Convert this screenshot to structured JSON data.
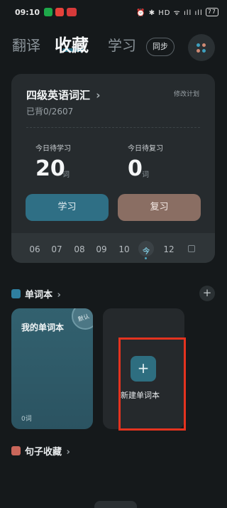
{
  "status_bar": {
    "time": "09:10",
    "system_text": "⏰ ✱ HD ᯤ ıll ıll",
    "battery": "77"
  },
  "header": {
    "tabs": [
      {
        "label": "翻译"
      },
      {
        "label": "收藏"
      },
      {
        "label": "学习"
      }
    ],
    "sync_label": "同步"
  },
  "plan_card": {
    "title": "四级英语词汇",
    "title_chevron": "›",
    "progress": "已背0/2607",
    "edit_label": "修改计划",
    "study_label": "今日待学习",
    "study_count": "20",
    "study_unit": "词",
    "review_label": "今日待复习",
    "review_count": "0",
    "review_unit": "词",
    "study_button": "学习",
    "review_button": "复习",
    "dates": [
      "06",
      "07",
      "08",
      "09",
      "10",
      "今",
      "12"
    ]
  },
  "wordbook_section": {
    "title": "单词本",
    "chevron": "›",
    "add_label": "+"
  },
  "wordbook": {
    "name": "我的单词本",
    "count": "0词",
    "badge": "默认"
  },
  "new_wordbook": {
    "icon": "+",
    "label": "新建单词本"
  },
  "sentence_section": {
    "title": "句子收藏",
    "chevron": "›"
  },
  "colors": {
    "accent": "#2f6f85",
    "review": "#8a6e63",
    "highlight": "#e4331f"
  }
}
